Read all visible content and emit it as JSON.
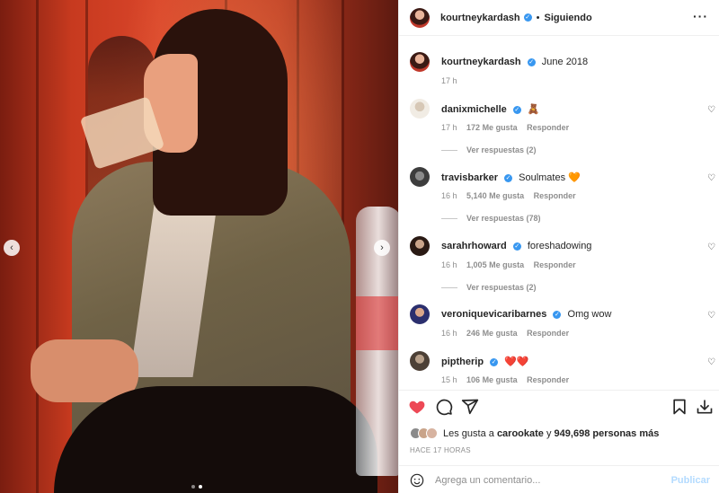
{
  "post": {
    "author": "kourtneykardash",
    "separator": "•",
    "follow_status": "Siguiendo",
    "more_icon": "more-horizontal-icon",
    "caption": "June 2018",
    "caption_time": "17 h"
  },
  "media": {
    "prev_icon": "‹",
    "next_icon": "›",
    "slides": 2,
    "active_slide": 2
  },
  "comments": [
    {
      "user": "danixmichelle",
      "text": "🧸",
      "time": "17 h",
      "likes": "172 Me gusta",
      "reply": "Responder",
      "replies": "Ver respuestas (2)"
    },
    {
      "user": "travisbarker",
      "text": "Soulmates 🧡",
      "time": "16 h",
      "likes": "5,140 Me gusta",
      "reply": "Responder",
      "replies": "Ver respuestas (78)"
    },
    {
      "user": "sarahrhoward",
      "text": "foreshadowing",
      "time": "16 h",
      "likes": "1,005 Me gusta",
      "reply": "Responder",
      "replies": "Ver respuestas (2)"
    },
    {
      "user": "veroniquevicaribarnes",
      "text": "Omg wow",
      "time": "16 h",
      "likes": "246 Me gusta",
      "reply": "Responder"
    },
    {
      "user": "piptherip",
      "text": "❤️❤️",
      "time": "15 h",
      "likes": "106 Me gusta",
      "reply": "Responder"
    }
  ],
  "engagement": {
    "likes_prefix": "Les gusta a",
    "liked_by": "carookate",
    "conjunction": "y",
    "others": "949,698 personas más",
    "timestamp": "HACE 17 HORAS"
  },
  "composer": {
    "placeholder": "Agrega un comentario...",
    "publish": "Publicar"
  },
  "colors": {
    "heart_liked": "#ed4956",
    "verified": "#3897f0",
    "publish_disabled": "#b3dbff"
  }
}
